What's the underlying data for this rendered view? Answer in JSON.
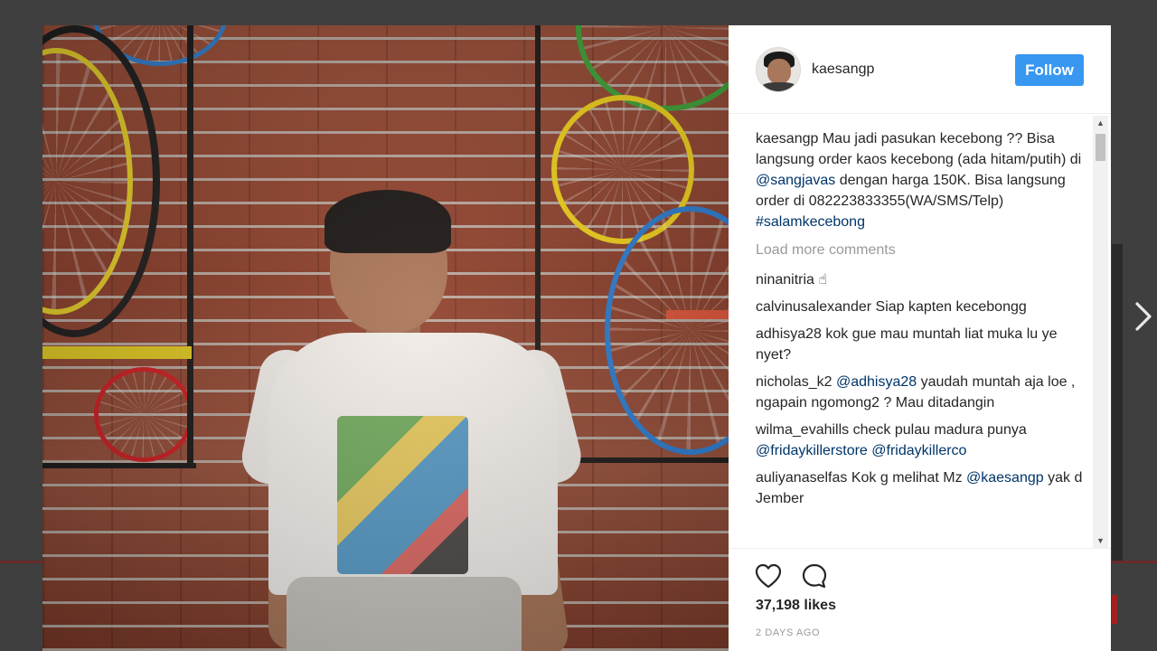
{
  "post": {
    "username": "kaesangp",
    "follow_label": "Follow",
    "caption": {
      "user": "kaesangp",
      "text_1": "Mau jadi pasukan kecebong ?? Bisa langsung order kaos kecebong (ada hitam/putih) di ",
      "mention": "@sangjavas",
      "text_2": " dengan harga 150K. Bisa langsung order di 082223833355(WA/SMS/Telp) ",
      "hashtag": "#salamkecebong"
    },
    "load_more": "Load more comments",
    "comments": [
      {
        "user": "ninanitria",
        "text": "☝"
      },
      {
        "user": "calvinusalexander",
        "text": "Siap kapten kecebongg"
      },
      {
        "user": "adhisya28",
        "text": "kok gue mau muntah liat muka lu ye nyet?"
      },
      {
        "user": "nicholas_k2",
        "mention": "@adhisya28",
        "text": " yaudah muntah aja loe , ngapain ngomong2 ? Mau ditadangin"
      },
      {
        "user": "wilma_evahills",
        "text": "check pulau madura punya ",
        "mention": "@fridaykillerstore",
        "mention2": "@fridaykillerco"
      },
      {
        "user": "auliyanaselfas",
        "text": "Kok g melihat Mz ",
        "mention": "@kaesangp",
        "text_after": " yak d Jember"
      }
    ],
    "likes": "37,198 likes",
    "timestamp": "2 DAYS AGO"
  },
  "icons": {
    "like": "heart-outline-icon",
    "comment": "comment-bubble-icon",
    "next": "chevron-right-icon"
  },
  "colors": {
    "follow_button": "#3897f0",
    "link": "#003569",
    "muted": "#999999",
    "overlay": "#3f3f3f"
  }
}
